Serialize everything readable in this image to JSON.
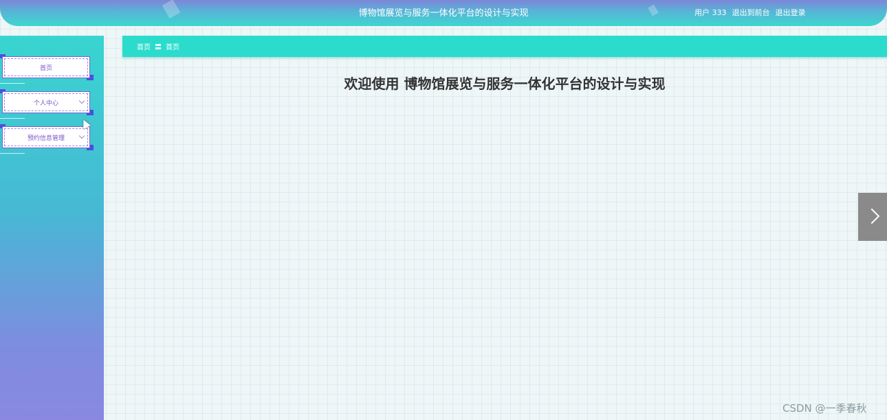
{
  "header": {
    "title": "博物馆展览与服务一体化平台的设计与实现",
    "user_label": "用户 333",
    "to_frontend": "退出到前台",
    "logout": "退出登录"
  },
  "sidebar": {
    "items": [
      {
        "label": "首页",
        "has_children": false
      },
      {
        "label": "个人中心",
        "has_children": true
      },
      {
        "label": "预约信息管理",
        "has_children": true
      }
    ]
  },
  "breadcrumb": {
    "items": [
      "首页",
      "首页"
    ],
    "separator": "〓"
  },
  "main": {
    "welcome": "欢迎使用 博物馆展览与服务一体化平台的设计与实现"
  },
  "watermark": "CSDN @一季春秋",
  "icons": {
    "next": "chevron-right-icon",
    "dropdown": "chevron-down-icon"
  },
  "colors": {
    "breadcrumb_bg": "#2bdccd",
    "menu_text": "#7a55c8",
    "header_top": "#7d86d8",
    "header_bottom": "#3ed6cf"
  }
}
